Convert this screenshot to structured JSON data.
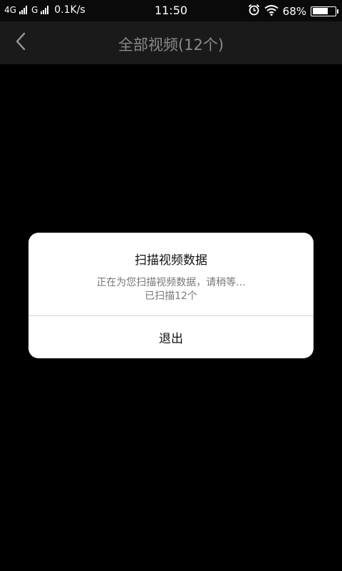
{
  "status_bar": {
    "network1": "4G",
    "network2": "G",
    "speed": "0.1K/s",
    "time": "11:50",
    "battery_percent": "68%",
    "battery_level": 0.68,
    "icons": [
      "signal-icon",
      "alarm-icon",
      "wifi-icon",
      "battery-icon"
    ]
  },
  "header": {
    "title": "全部视频(12个)",
    "back_icon": "chevron-left-icon"
  },
  "dialog": {
    "title": "扫描视频数据",
    "message_line1": "正在为您扫描视频数据，请稍等...",
    "message_line2": "已扫描12个",
    "button_label": "退出"
  },
  "colors": {
    "background": "#000000",
    "header_bg": "#1a1a1a",
    "header_title": "#8a8a8a",
    "dialog_bg": "#ffffff",
    "dialog_text_secondary": "#777777"
  }
}
